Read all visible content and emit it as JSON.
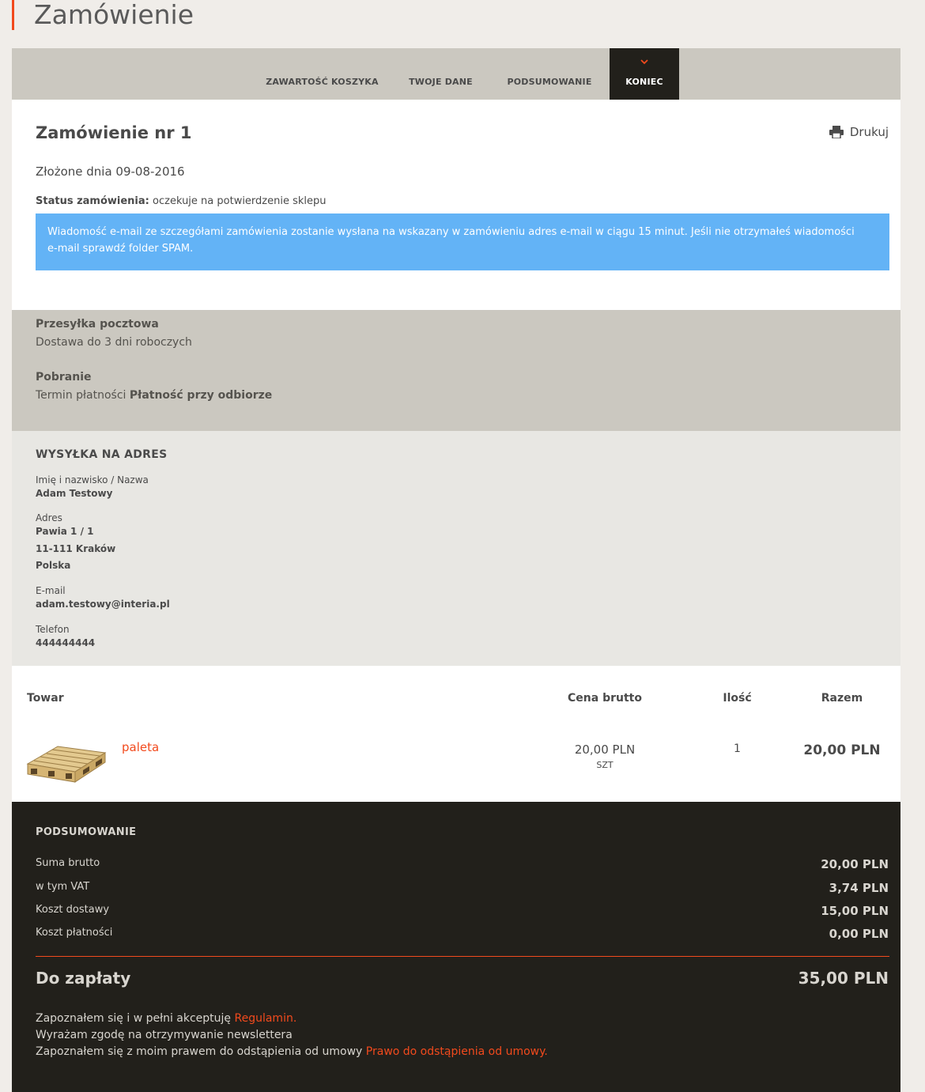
{
  "page": {
    "title": "Zamówienie"
  },
  "steps": [
    {
      "label": "ZAWARTOŚĆ KOSZYKA"
    },
    {
      "label": "TWOJE DANE"
    },
    {
      "label": "PODSUMOWANIE"
    },
    {
      "label": "KONIEC",
      "active": true
    }
  ],
  "order": {
    "title": "Zamówienie nr 1",
    "print_label": "Drukuj",
    "placed": "Złożone dnia 09-08-2016",
    "status_label": "Status zamówienia:",
    "status_value": "oczekuje na potwierdzenie sklepu",
    "info_line1": "Wiadomość e-mail ze szczegółami zamówienia zostanie wysłana na wskazany w zamówieniu adres e-mail w ciągu 15 minut. Jeśli nie otrzymałeś wiadomości",
    "info_line2": "e-mail sprawdź folder SPAM."
  },
  "delivery": {
    "shipping_label": "Przesyłka pocztowa",
    "shipping_value": "Dostawa do 3 dni roboczych",
    "payment_label": "Pobranie",
    "payment_prefix": "Termin płatności",
    "payment_value": "Płatność przy odbiorze"
  },
  "address": {
    "title": "WYSYŁKA NA ADRES",
    "name_label": "Imię i nazwisko / Nazwa",
    "name_value": "Adam Testowy",
    "addr_label": "Adres",
    "addr_line1": "Pawia 1 / 1",
    "addr_line2": "11-111 Kraków",
    "addr_line3": "Polska",
    "email_label": "E-mail",
    "email_value": "adam.testowy@interia.pl",
    "phone_label": "Telefon",
    "phone_value": "444444444"
  },
  "items": {
    "headers": {
      "product": "Towar",
      "price": "Cena brutto",
      "qty": "Ilość",
      "total": "Razem"
    },
    "rows": [
      {
        "name": "paleta",
        "price": "20,00 PLN",
        "unit": "SZT",
        "qty": "1",
        "total": "20,00 PLN"
      }
    ]
  },
  "summary": {
    "title": "PODSUMOWANIE",
    "rows": [
      {
        "label": "Suma brutto",
        "value": "20,00 PLN"
      },
      {
        "label": "w tym VAT",
        "value": "3,74 PLN"
      },
      {
        "label": "Koszt dostawy",
        "value": "15,00 PLN"
      },
      {
        "label": "Koszt płatności",
        "value": "0,00 PLN"
      }
    ],
    "pay_label": "Do zapłaty",
    "pay_value": "35,00 PLN",
    "consent1_text": "Zapoznałem się i w pełni akceptuję",
    "consent1_link": "Regulamin",
    "consent2_text": "Wyrażam zgodę na otrzymywanie newslettera",
    "consent3_text": "Zapoznałem się z moim prawem do odstąpienia od umowy",
    "consent3_link": "Prawo do odstąpienia od umowy"
  },
  "colors": {
    "accent": "#f24a1d",
    "info": "#63b3f6",
    "dark": "#22201b",
    "beige": "#cbc8c0"
  },
  "icons": {
    "print": "printer-icon",
    "step_active": "chevron-down-icon"
  }
}
